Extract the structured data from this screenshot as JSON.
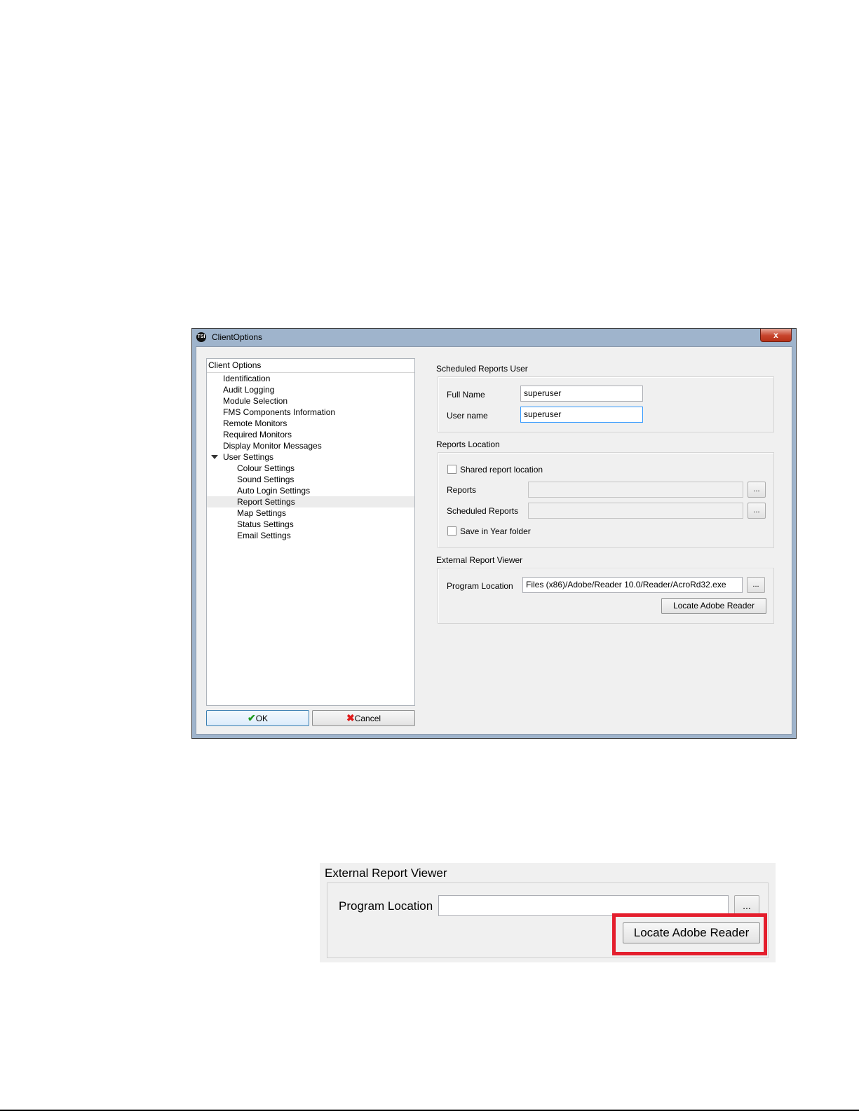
{
  "window": {
    "title": "ClientOptions",
    "icon_name": "tsi-logo-icon",
    "close_label": "x"
  },
  "tree": {
    "header": "Client Options",
    "items": [
      "Identification",
      "Audit Logging",
      "Module Selection",
      "FMS Components Information",
      "Remote Monitors",
      "Required Monitors",
      "Display Monitor Messages",
      "User Settings"
    ],
    "children": [
      "Colour Settings",
      "Sound Settings",
      "Auto Login Settings",
      "Report Settings",
      "Map Settings",
      "Status Settings",
      "Email Settings"
    ],
    "selected": "Report Settings"
  },
  "buttons": {
    "ok": "OK",
    "cancel": "Cancel"
  },
  "scheduled_reports_user": {
    "title": "Scheduled Reports User",
    "full_name_label": "Full Name",
    "full_name_value": "superuser",
    "user_name_label": "User name",
    "user_name_value": "superuser"
  },
  "reports_location": {
    "title": "Reports Location",
    "shared_label": "Shared report location",
    "shared_checked": false,
    "reports_label": "Reports",
    "reports_value": "",
    "scheduled_label": "Scheduled Reports",
    "scheduled_value": "",
    "year_folder_label": "Save in Year folder",
    "year_folder_checked": false,
    "browse_label": "..."
  },
  "external_viewer": {
    "title": "External Report Viewer",
    "program_label": "Program Location",
    "program_value": "Files (x86)/Adobe/Reader 10.0/Reader/AcroRd32.exe",
    "browse_label": "...",
    "locate_label": "Locate Adobe Reader"
  },
  "zoom_inset": {
    "title": "External Report Viewer",
    "program_label": "Program Location",
    "program_value": "",
    "browse_label": "...",
    "locate_label": "Locate Adobe Reader",
    "highlight_color": "#e41e2d"
  }
}
